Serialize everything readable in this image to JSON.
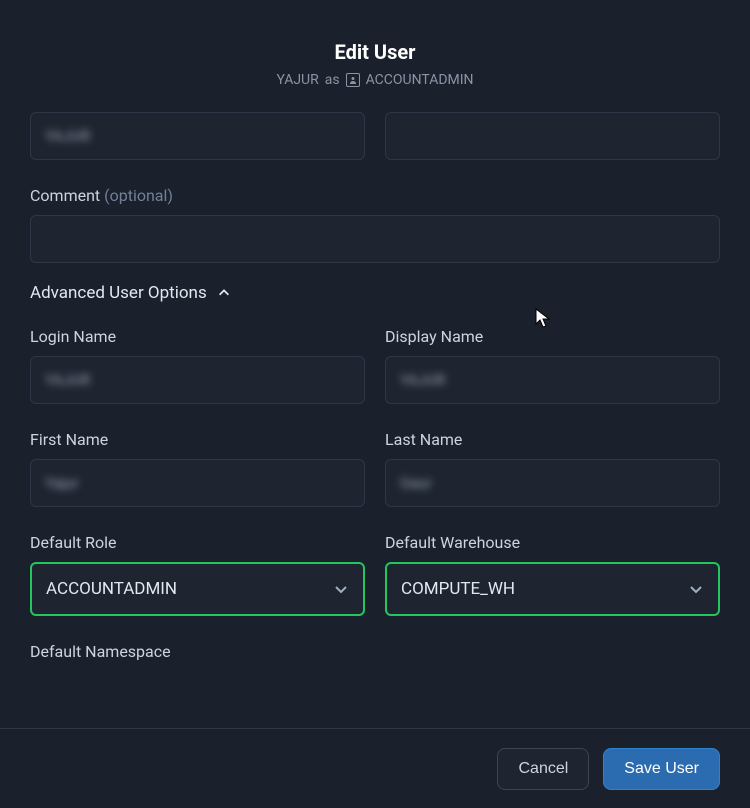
{
  "header": {
    "title": "Edit User",
    "subtitle_user": "YAJUR",
    "subtitle_as": "as",
    "subtitle_role": "ACCOUNTADMIN"
  },
  "top_row": {
    "left_value": "YAJUR",
    "right_value": ""
  },
  "comment": {
    "label": "Comment",
    "optional": "(optional)",
    "value": ""
  },
  "advanced": {
    "section_title": "Advanced User Options",
    "login_name": {
      "label": "Login Name",
      "value": "YAJUR"
    },
    "display_name": {
      "label": "Display Name",
      "value": "YAJUR"
    },
    "first_name": {
      "label": "First Name",
      "value": "Yajur"
    },
    "last_name": {
      "label": "Last Name",
      "value": "Gaur"
    },
    "default_role": {
      "label": "Default Role",
      "value": "ACCOUNTADMIN"
    },
    "default_warehouse": {
      "label": "Default Warehouse",
      "value": "COMPUTE_WH"
    },
    "default_namespace": {
      "label": "Default Namespace",
      "value": ""
    }
  },
  "footer": {
    "cancel": "Cancel",
    "save": "Save User"
  }
}
